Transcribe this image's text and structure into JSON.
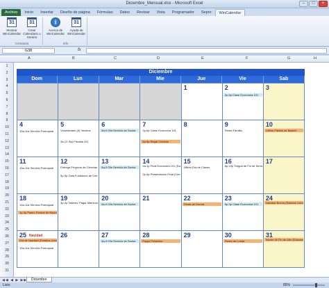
{
  "window": {
    "title": "Diciembre_Mensual.xlsx - Microsoft Excel"
  },
  "ribbon": {
    "tabs": [
      "Archivo",
      "Inicio",
      "Insertar",
      "Diseño de página",
      "Fórmulas",
      "Datos",
      "Revisar",
      "Vista",
      "Programador",
      "Sepro",
      "WinCalendar"
    ],
    "active_tab": "WinCalendar",
    "groups": [
      {
        "label": "Comando",
        "buttons": [
          "Mostrar WinCalendar",
          "Crear Calendario u Horario"
        ]
      },
      {
        "label": "Info",
        "buttons": [
          "Acerca de WinCalendar",
          "Ayuda de WinCalendar"
        ]
      }
    ],
    "calendar_icon_number": "31",
    "info_icon_glyph": "i"
  },
  "formula_bar": {
    "name_box": "G38",
    "fx": "fx",
    "value": ""
  },
  "columns": [
    "A",
    "B",
    "C",
    "D",
    "E",
    "F",
    "G",
    "H"
  ],
  "rows": [
    "1",
    "2",
    "3",
    "4",
    "5",
    "6",
    "7",
    "8",
    "9",
    "10",
    "11",
    "12",
    "13",
    "14",
    "15",
    "16",
    "17",
    "18",
    "19",
    "20",
    "21",
    "22",
    "23",
    "24",
    "25",
    "26",
    "27",
    "28",
    "29",
    "30",
    "31"
  ],
  "calendar": {
    "month": "Diciembre",
    "weekdays": [
      "Dom",
      "Lun",
      "Mar",
      "Mie",
      "Jue",
      "Vie",
      "Sab"
    ],
    "weeks": [
      [
        {
          "day": "",
          "empty": true
        },
        {
          "day": "",
          "empty": true
        },
        {
          "day": "",
          "empty": true
        },
        {
          "day": "",
          "empty": true
        },
        {
          "day": "1",
          "events": []
        },
        {
          "day": "2",
          "events": [
            {
              "text": "2p-5p Clase Economía 101",
              "style": "blue",
              "y": 14
            }
          ]
        },
        {
          "day": "3",
          "events": []
        }
      ],
      [
        {
          "day": "4",
          "events": [
            {
              "text": "10a-11a Servicio Parroquial",
              "style": "plain",
              "y": 13
            }
          ]
        },
        {
          "day": "5",
          "events": [
            {
              "text": "Voluntariado (9) Vecinos",
              "style": "plain",
              "y": 12
            },
            {
              "text": "9a-12 Sky Fiscalia 101",
              "style": "plain",
              "y": 28
            }
          ]
        },
        {
          "day": "6",
          "events": [
            {
              "text": "8a-9 Ofa Servicio de Doctor",
              "style": "blue",
              "y": 12
            }
          ]
        },
        {
          "day": "7",
          "events": [
            {
              "text": "2p-6p Clase Economía 101",
              "style": "plain",
              "y": 12
            },
            {
              "text": "6p-8p Regal Cinbank",
              "style": "orange",
              "y": 28
            }
          ]
        },
        {
          "day": "8",
          "events": []
        },
        {
          "day": "9",
          "events": [
            {
              "text": "Fiesta Familia",
              "style": "plain",
              "y": 12
            }
          ]
        },
        {
          "day": "10",
          "events": [
            {
              "text": "Ultimo Partido de Basket",
              "style": "orange",
              "y": 12
            }
          ]
        }
      ],
      [
        {
          "day": "11",
          "events": [
            {
              "text": "10a-11a Servicio Parroquial",
              "style": "plain",
              "y": 13
            }
          ]
        },
        {
          "day": "12",
          "events": [
            {
              "text": "Entrega Proyecto de Ciencias",
              "style": "plain",
              "y": 12
            },
            {
              "text": "5p-9p Gala Fundación de Ciencias",
              "style": "plain",
              "y": 24
            }
          ]
        },
        {
          "day": "13",
          "events": [
            {
              "text": "8a-9 Ofa Servicio de Doctor",
              "style": "blue",
              "y": 12
            }
          ]
        },
        {
          "day": "14",
          "events": [
            {
              "text": "9a-1p Final Economía 101 (Salón 3b)",
              "style": "plain",
              "y": 10
            },
            {
              "text": "2p-5p Presentacion Final (Ciencia Alemana)",
              "style": "plain",
              "y": 22
            }
          ]
        },
        {
          "day": "15",
          "events": [
            {
              "text": "Último Día de Clases",
              "style": "plain",
              "y": 12
            }
          ]
        },
        {
          "day": "16",
          "events": [
            {
              "text": "6p-10p Trégua de Fin de Semestre (Bil Hopper)",
              "style": "plain",
              "y": 10
            }
          ]
        },
        {
          "day": "17",
          "events": []
        }
      ],
      [
        {
          "day": "18",
          "events": [
            {
              "text": "10a-11a Servicio Parroquial",
              "style": "plain",
              "y": 13
            },
            {
              "text": "1p-3p Paseo Fiestas de Navidad",
              "style": "orange",
              "y": 24
            }
          ]
        },
        {
          "day": "19",
          "events": [
            {
              "text": "3p-4p Talleres 'Pagar Matricula para Proximo Semestre'",
              "style": "plain",
              "y": 10
            }
          ]
        },
        {
          "day": "20",
          "events": [
            {
              "text": "8a-9 Ofa Servicio de Doctor",
              "style": "blue",
              "y": 12
            }
          ]
        },
        {
          "day": "21",
          "events": []
        },
        {
          "day": "22",
          "events": [
            {
              "text": "Fiesta de Dorma",
              "style": "orange",
              "y": 12
            }
          ]
        },
        {
          "day": "23",
          "events": [
            {
              "text": "9p-3p Clase Economía 101",
              "style": "blue",
              "y": 12
            }
          ]
        },
        {
          "day": "24",
          "events": [
            {
              "text": "Navidad Buena (Estados Unidos)",
              "style": "orange",
              "y": 10
            }
          ]
        }
      ],
      [
        {
          "day": "25",
          "holiday": "Navidad",
          "events": [
            {
              "text": "Día de Navidad (Estados Unidos)",
              "style": "orange",
              "y": 11
            },
            {
              "text": "10a-11a Servicio Parroquial",
              "style": "plain",
              "y": 22
            }
          ]
        },
        {
          "day": "26",
          "events": []
        },
        {
          "day": "27",
          "events": [
            {
              "text": "8a-9 Ofa Servicio de Doctor",
              "style": "blue",
              "y": 12
            }
          ]
        },
        {
          "day": "28",
          "events": [
            {
              "text": "Pagar Prestamo",
              "style": "orange",
              "y": 12
            }
          ]
        },
        {
          "day": "29",
          "events": []
        },
        {
          "day": "30",
          "events": [
            {
              "text": "Fiesta de Londa",
              "style": "orange",
              "y": 12
            }
          ]
        },
        {
          "day": "31",
          "events": [
            {
              "text": "Noche de Fin de Año (Estados Unidos)",
              "style": "orange",
              "y": 10
            }
          ]
        }
      ]
    ]
  },
  "sheet_tabs": [
    "Diciembre"
  ],
  "status": {
    "ready": "Listo",
    "zoom": "85%"
  }
}
